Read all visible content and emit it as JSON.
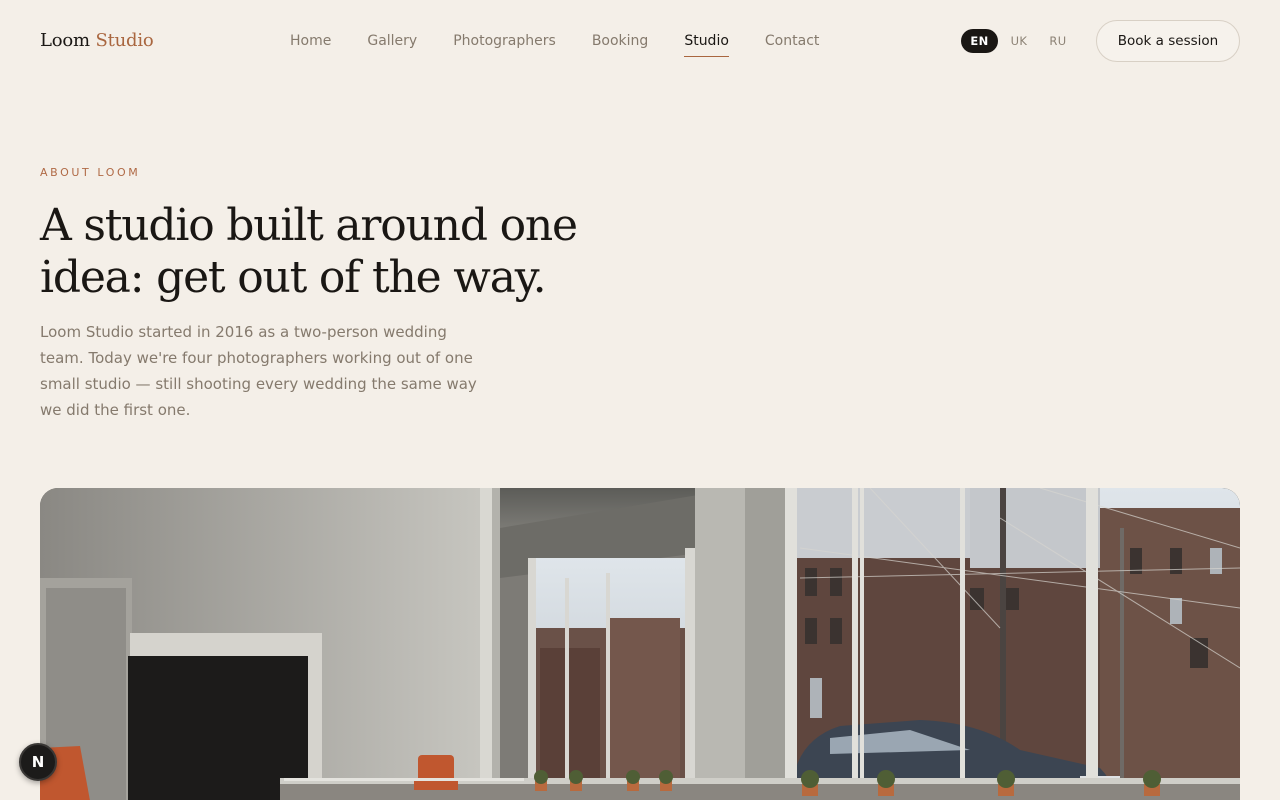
{
  "brand": {
    "name_part1": "Loom",
    "name_part2": "Studio",
    "accent_color": "#a9663f"
  },
  "nav": {
    "items": [
      {
        "label": "Home",
        "active": false
      },
      {
        "label": "Gallery",
        "active": false
      },
      {
        "label": "Photographers",
        "active": false
      },
      {
        "label": "Booking",
        "active": false
      },
      {
        "label": "Studio",
        "active": true
      },
      {
        "label": "Contact",
        "active": false
      }
    ]
  },
  "languages": {
    "options": [
      "EN",
      "UK",
      "RU"
    ],
    "selected": "EN"
  },
  "cta": {
    "label": "Book a session"
  },
  "about": {
    "eyebrow": "ABOUT LOOM",
    "headline_line1": "A studio built around one",
    "headline_line2": "idea: get out of the way.",
    "intro": "Loom Studio started in 2016 as a two-person wedding team. Today we're four photographers working out of one small studio — still shooting every wedding the same way we did the first one."
  },
  "badge": {
    "label": "N"
  },
  "colors": {
    "background": "#f4efe8",
    "text": "#1a1714",
    "muted": "#857a6d",
    "accent": "#a9663f"
  }
}
